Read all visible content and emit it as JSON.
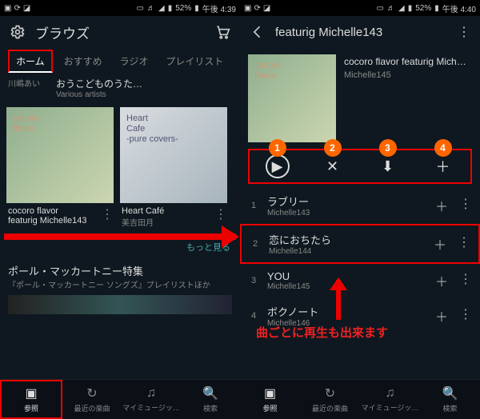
{
  "status": {
    "battery": "52%",
    "time_left": "午後 4:39",
    "time_right": "午後 4:40"
  },
  "left": {
    "title": "ブラウズ",
    "tabs": [
      "ホーム",
      "おすすめ",
      "ラジオ",
      "プレイリスト"
    ],
    "side_artist": "川嶋あい",
    "sec1_title": "おうこどものうた…",
    "sec1_artist": "Various artists",
    "album1": {
      "art_label": "cocoro\nflavor",
      "title": "cocoro flavor",
      "subtitle": "featurig Michelle143",
      "artist": ""
    },
    "album2": {
      "art_label": "Heart\nCafe\n-pure covers-",
      "title": "Heart Café",
      "artist": "美吉田月"
    },
    "more": "もっと見る",
    "feature_title": "ポール・マッカートニー特集",
    "feature_sub": "『ポール・マッカートニー ソングズ』プレイリストほか"
  },
  "right": {
    "header": "featurig Michelle143",
    "album_badge": "cocoro\nflavor",
    "detail_title": "cocoro flavor   featurig Mich…",
    "detail_artist": "Michelle145",
    "badges": [
      "1",
      "2",
      "3",
      "4"
    ],
    "tracks": [
      {
        "num": "1",
        "title": "ラブリー",
        "artist": "Michelle143"
      },
      {
        "num": "2",
        "title": "恋におちたら",
        "artist": "Michelle144"
      },
      {
        "num": "3",
        "title": "YOU",
        "artist": "Michelle145"
      },
      {
        "num": "4",
        "title": "ボクノート",
        "artist": "Michelle146"
      }
    ],
    "annotation": "曲ごとに再生も出来ます"
  },
  "nav": {
    "items": [
      "参照",
      "最近の楽曲",
      "マイミュージッ…",
      "検索"
    ]
  },
  "icons": {
    "gear": "gear",
    "cart": "cart",
    "back": "back",
    "menu": "menu",
    "play": "play",
    "shuffle": "shuffle",
    "download": "download",
    "plus": "plus"
  }
}
